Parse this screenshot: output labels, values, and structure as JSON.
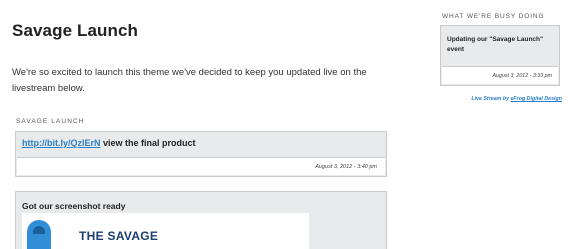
{
  "main": {
    "title": "Savage Launch",
    "intro": "We're so excited to launch this theme we've decided to keep you updated live on the livestream below.",
    "section_label": "SAVAGE LAUNCH",
    "posts": [
      {
        "link": "http://bit.ly/QzlErN",
        "text": " view the final product",
        "timestamp": "August 3, 2012 - 3:40 pm"
      },
      {
        "text": "Got our screenshot ready",
        "image_caption": "THE SAVAGE"
      }
    ]
  },
  "sidebar": {
    "label": "WHAT WE'RE BUSY DOING",
    "card": {
      "text": "Updating our \"Savage Launch\" event",
      "timestamp": "August 3, 2012 - 3:33 pm"
    },
    "credit_prefix": "Live Stream by ",
    "credit_link": "eFrog Digital Design"
  },
  "colors": {
    "link": "#2a7fc9",
    "card_bg": "#e9eaec",
    "card_border": "#c9cacd"
  }
}
